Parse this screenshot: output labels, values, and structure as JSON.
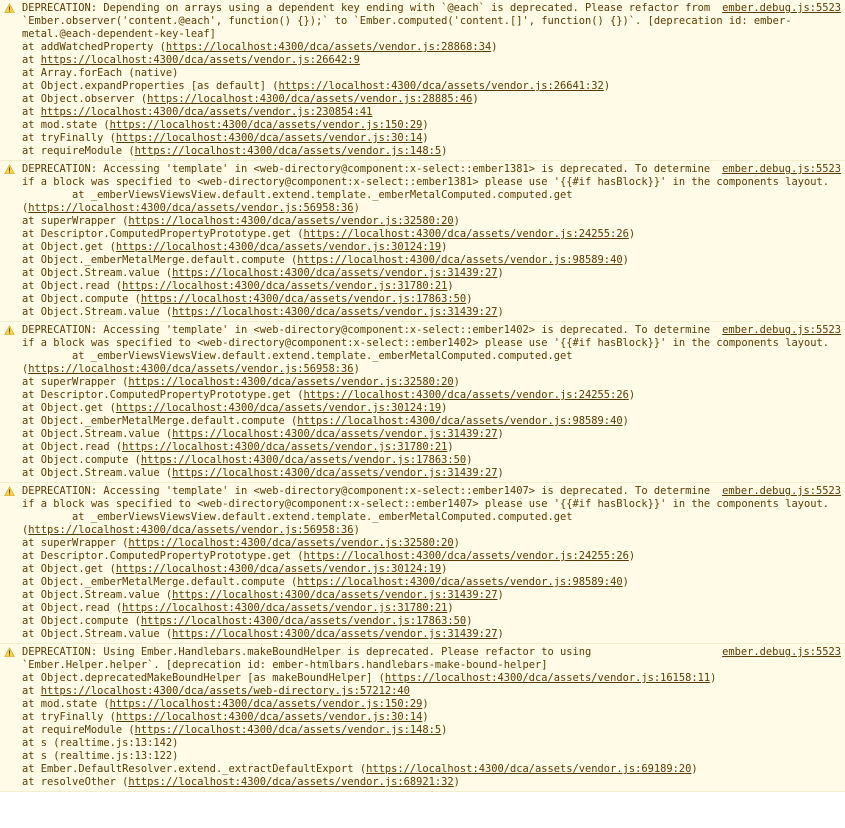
{
  "icon": "warning",
  "entries": [
    {
      "source": "ember.debug.js:5523",
      "message": "DEPRECATION: Depending on arrays using a dependent key ending with `@each` is deprecated. Please refactor from `Ember.observer('content.@each', function() {});` to `Ember.computed('content.[]', function() {})`. [deprecation id: ember-metal.@each-dependent-key-leaf]",
      "stack": [
        {
          "fn": "addWatchedProperty",
          "link": "https://localhost:4300/dca/assets/vendor.js:28868:34"
        },
        {
          "fn": "",
          "link": "https://localhost:4300/dca/assets/vendor.js:26642:9"
        },
        {
          "fn": "Array.forEach (native)",
          "link": ""
        },
        {
          "fn": "Object.expandProperties [as default]",
          "link": "https://localhost:4300/dca/assets/vendor.js:26641:32"
        },
        {
          "fn": "Object.observer",
          "link": "https://localhost:4300/dca/assets/vendor.js:28885:46"
        },
        {
          "fn": "",
          "link": "https://localhost:4300/dca/assets/vendor.js:230854:41"
        },
        {
          "fn": "mod.state",
          "link": "https://localhost:4300/dca/assets/vendor.js:150:29"
        },
        {
          "fn": "tryFinally",
          "link": "https://localhost:4300/dca/assets/vendor.js:30:14"
        },
        {
          "fn": "requireModule",
          "link": "https://localhost:4300/dca/assets/vendor.js:148:5"
        }
      ]
    },
    {
      "source": "ember.debug.js:5523",
      "message": "DEPRECATION: Accessing 'template' in <web-directory@component:x-select::ember1381> is deprecated. To determine if a block was specified to <web-directory@component:x-select::ember1381> please use '{{#if hasBlock}}' in the components layout.",
      "stack": [
        {
          "fn": "_emberViewsViewsView.default.extend.template._emberMetalComputed.computed.get",
          "link": "https://localhost:4300/dca/assets/vendor.js:56958:36",
          "wrap": true
        },
        {
          "fn": "superWrapper",
          "link": "https://localhost:4300/dca/assets/vendor.js:32580:20"
        },
        {
          "fn": "Descriptor.ComputedPropertyPrototype.get",
          "link": "https://localhost:4300/dca/assets/vendor.js:24255:26"
        },
        {
          "fn": "Object.get",
          "link": "https://localhost:4300/dca/assets/vendor.js:30124:19"
        },
        {
          "fn": "Object._emberMetalMerge.default.compute",
          "link": "https://localhost:4300/dca/assets/vendor.js:98589:40"
        },
        {
          "fn": "Object.Stream.value",
          "link": "https://localhost:4300/dca/assets/vendor.js:31439:27"
        },
        {
          "fn": "Object.read",
          "link": "https://localhost:4300/dca/assets/vendor.js:31780:21"
        },
        {
          "fn": "Object.compute",
          "link": "https://localhost:4300/dca/assets/vendor.js:17863:50"
        },
        {
          "fn": "Object.Stream.value",
          "link": "https://localhost:4300/dca/assets/vendor.js:31439:27"
        }
      ]
    },
    {
      "source": "ember.debug.js:5523",
      "message": "DEPRECATION: Accessing 'template' in <web-directory@component:x-select::ember1402> is deprecated. To determine if a block was specified to <web-directory@component:x-select::ember1402> please use '{{#if hasBlock}}' in the components layout.",
      "stack": [
        {
          "fn": "_emberViewsViewsView.default.extend.template._emberMetalComputed.computed.get",
          "link": "https://localhost:4300/dca/assets/vendor.js:56958:36",
          "wrap": true
        },
        {
          "fn": "superWrapper",
          "link": "https://localhost:4300/dca/assets/vendor.js:32580:20"
        },
        {
          "fn": "Descriptor.ComputedPropertyPrototype.get",
          "link": "https://localhost:4300/dca/assets/vendor.js:24255:26"
        },
        {
          "fn": "Object.get",
          "link": "https://localhost:4300/dca/assets/vendor.js:30124:19"
        },
        {
          "fn": "Object._emberMetalMerge.default.compute",
          "link": "https://localhost:4300/dca/assets/vendor.js:98589:40"
        },
        {
          "fn": "Object.Stream.value",
          "link": "https://localhost:4300/dca/assets/vendor.js:31439:27"
        },
        {
          "fn": "Object.read",
          "link": "https://localhost:4300/dca/assets/vendor.js:31780:21"
        },
        {
          "fn": "Object.compute",
          "link": "https://localhost:4300/dca/assets/vendor.js:17863:50"
        },
        {
          "fn": "Object.Stream.value",
          "link": "https://localhost:4300/dca/assets/vendor.js:31439:27"
        }
      ]
    },
    {
      "source": "ember.debug.js:5523",
      "message": "DEPRECATION: Accessing 'template' in <web-directory@component:x-select::ember1407> is deprecated. To determine if a block was specified to <web-directory@component:x-select::ember1407> please use '{{#if hasBlock}}' in the components layout.",
      "stack": [
        {
          "fn": "_emberViewsViewsView.default.extend.template._emberMetalComputed.computed.get",
          "link": "https://localhost:4300/dca/assets/vendor.js:56958:36",
          "wrap": true
        },
        {
          "fn": "superWrapper",
          "link": "https://localhost:4300/dca/assets/vendor.js:32580:20"
        },
        {
          "fn": "Descriptor.ComputedPropertyPrototype.get",
          "link": "https://localhost:4300/dca/assets/vendor.js:24255:26"
        },
        {
          "fn": "Object.get",
          "link": "https://localhost:4300/dca/assets/vendor.js:30124:19"
        },
        {
          "fn": "Object._emberMetalMerge.default.compute",
          "link": "https://localhost:4300/dca/assets/vendor.js:98589:40"
        },
        {
          "fn": "Object.Stream.value",
          "link": "https://localhost:4300/dca/assets/vendor.js:31439:27"
        },
        {
          "fn": "Object.read",
          "link": "https://localhost:4300/dca/assets/vendor.js:31780:21"
        },
        {
          "fn": "Object.compute",
          "link": "https://localhost:4300/dca/assets/vendor.js:17863:50"
        },
        {
          "fn": "Object.Stream.value",
          "link": "https://localhost:4300/dca/assets/vendor.js:31439:27"
        }
      ]
    },
    {
      "source": "ember.debug.js:5523",
      "message": "DEPRECATION: Using Ember.Handlebars.makeBoundHelper is deprecated. Please refactor to using `Ember.Helper.helper`. [deprecation id: ember-htmlbars.handlebars-make-bound-helper]",
      "stack": [
        {
          "fn": "Object.deprecatedMakeBoundHelper [as makeBoundHelper]",
          "link": "https://localhost:4300/dca/assets/vendor.js:16158:11"
        },
        {
          "fn": "",
          "link": "https://localhost:4300/dca/assets/web-directory.js:57212:40"
        },
        {
          "fn": "mod.state",
          "link": "https://localhost:4300/dca/assets/vendor.js:150:29"
        },
        {
          "fn": "tryFinally",
          "link": "https://localhost:4300/dca/assets/vendor.js:30:14"
        },
        {
          "fn": "requireModule",
          "link": "https://localhost:4300/dca/assets/vendor.js:148:5"
        },
        {
          "fn": "s (realtime.js:13:142)",
          "link": ""
        },
        {
          "fn": "s (realtime.js:13:122)",
          "link": ""
        },
        {
          "fn": "Ember.DefaultResolver.extend._extractDefaultExport",
          "link": "https://localhost:4300/dca/assets/vendor.js:69189:20"
        },
        {
          "fn": "resolveOther",
          "link": "https://localhost:4300/dca/assets/vendor.js:68921:32"
        }
      ]
    }
  ]
}
